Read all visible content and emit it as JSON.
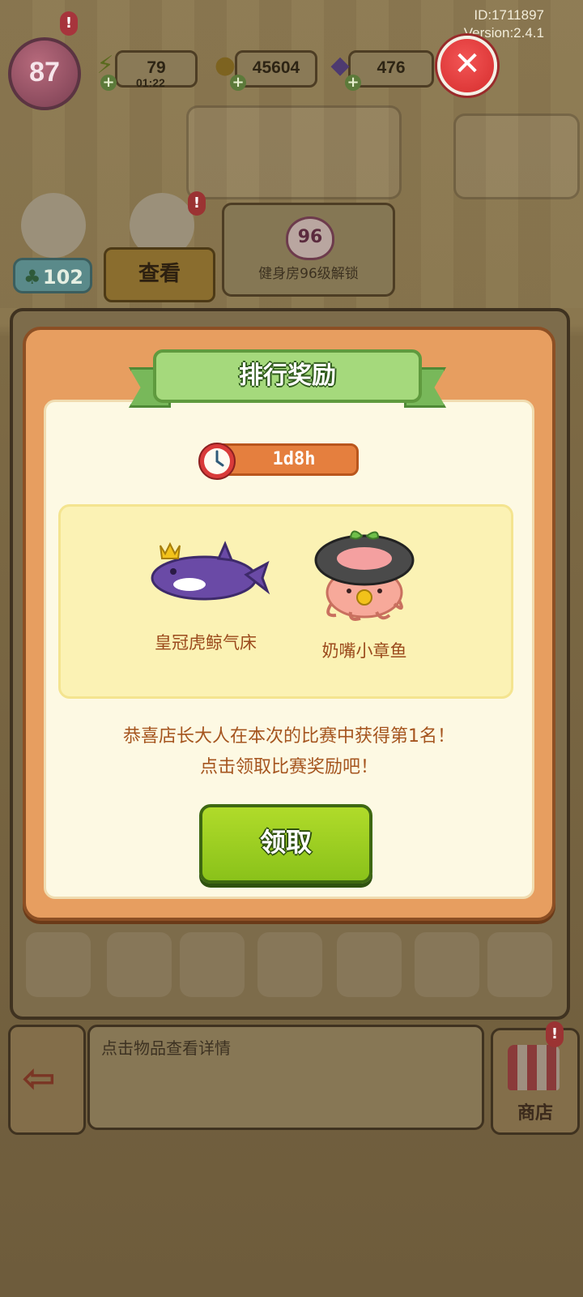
{
  "status": {
    "id_text": "ID:1711897",
    "version_text": "Version:2.4.1"
  },
  "hud": {
    "level": "87",
    "level_alert": "!",
    "energy": "79",
    "energy_timer": "01:22",
    "coins": "45604",
    "gems": "476",
    "icons": {
      "energy": "lightning-icon",
      "coins": "coin-icon",
      "gems": "gem-icon",
      "plus": "plus-icon"
    }
  },
  "scene": {
    "clover_count": "102",
    "view_button": "查看",
    "unlock": {
      "level": "96",
      "text": "健身房96级解锁"
    },
    "alert": "!"
  },
  "modal": {
    "title": "排行奖励",
    "close_icon": "close-icon",
    "timer": "1d8h",
    "rewards": [
      {
        "name": "皇冠虎鲸气床",
        "icon": "crown-orca-float-icon"
      },
      {
        "name": "奶嘴小章鱼",
        "icon": "pacifier-octopus-icon"
      }
    ],
    "congrats_line1": "恭喜店长大人在本次的比赛中获得第1名！",
    "congrats_line2": "点击领取比赛奖励吧！",
    "claim_button": "领取"
  },
  "bottom": {
    "description_placeholder": "点击物品查看详情",
    "shop_label": "商店",
    "shop_alert": "!"
  },
  "colors": {
    "modal_frame": "#e79e60",
    "modal_inner": "#fdf9e3",
    "ribbon_green": "#a5d97c",
    "claim_green": "#9dcf22",
    "close_red": "#e03a3a",
    "timer_orange": "#e57f3e",
    "text_brown": "#9b4a1c"
  }
}
